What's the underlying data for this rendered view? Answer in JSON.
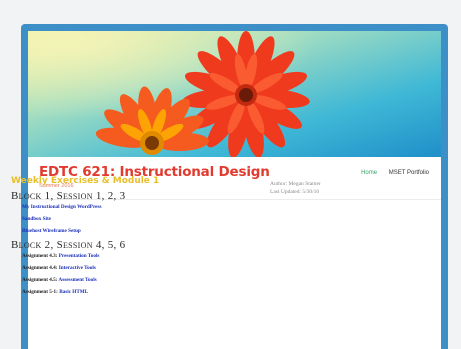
{
  "site": {
    "title": "EDTC 621: Instructional Design",
    "tagline": "Summer 2016"
  },
  "nav": {
    "items": [
      {
        "label": "Home",
        "active": true
      },
      {
        "label": "MSET Portfolio",
        "active": false
      }
    ]
  },
  "main": {
    "title": "Weekly Exercises & Module 1",
    "blocks": [
      {
        "heading": "Block 1, Session 1, 2, 3",
        "links": [
          {
            "prefix": "",
            "label": "My Instructional Design WordPress"
          },
          {
            "prefix": "",
            "label": "Sandbox Site"
          },
          {
            "prefix": "",
            "label": "Bluehost Wireframe Setup"
          }
        ]
      },
      {
        "heading": "Block 2, Session 4, 5, 6",
        "links": [
          {
            "prefix": "Assignment 4.3: ",
            "label": "Presentation Tools"
          },
          {
            "prefix": "Assignment 4.4: ",
            "label": "Interactive Tools"
          },
          {
            "prefix": "Assignment 4.5: ",
            "label": "Assessment Tools"
          },
          {
            "prefix": "Assignment 5-1: ",
            "label": "Basic HTML"
          }
        ]
      }
    ]
  },
  "sidebar": {
    "author": "Author: Megan Stamer",
    "updated": "Last Updated: 5/30/16"
  },
  "colors": {
    "frame": "#3d8fc7",
    "title": "#e23a2f",
    "section_title": "#e8bf2a",
    "link": "#1a2fb8",
    "nav_active": "#3aa56a"
  }
}
